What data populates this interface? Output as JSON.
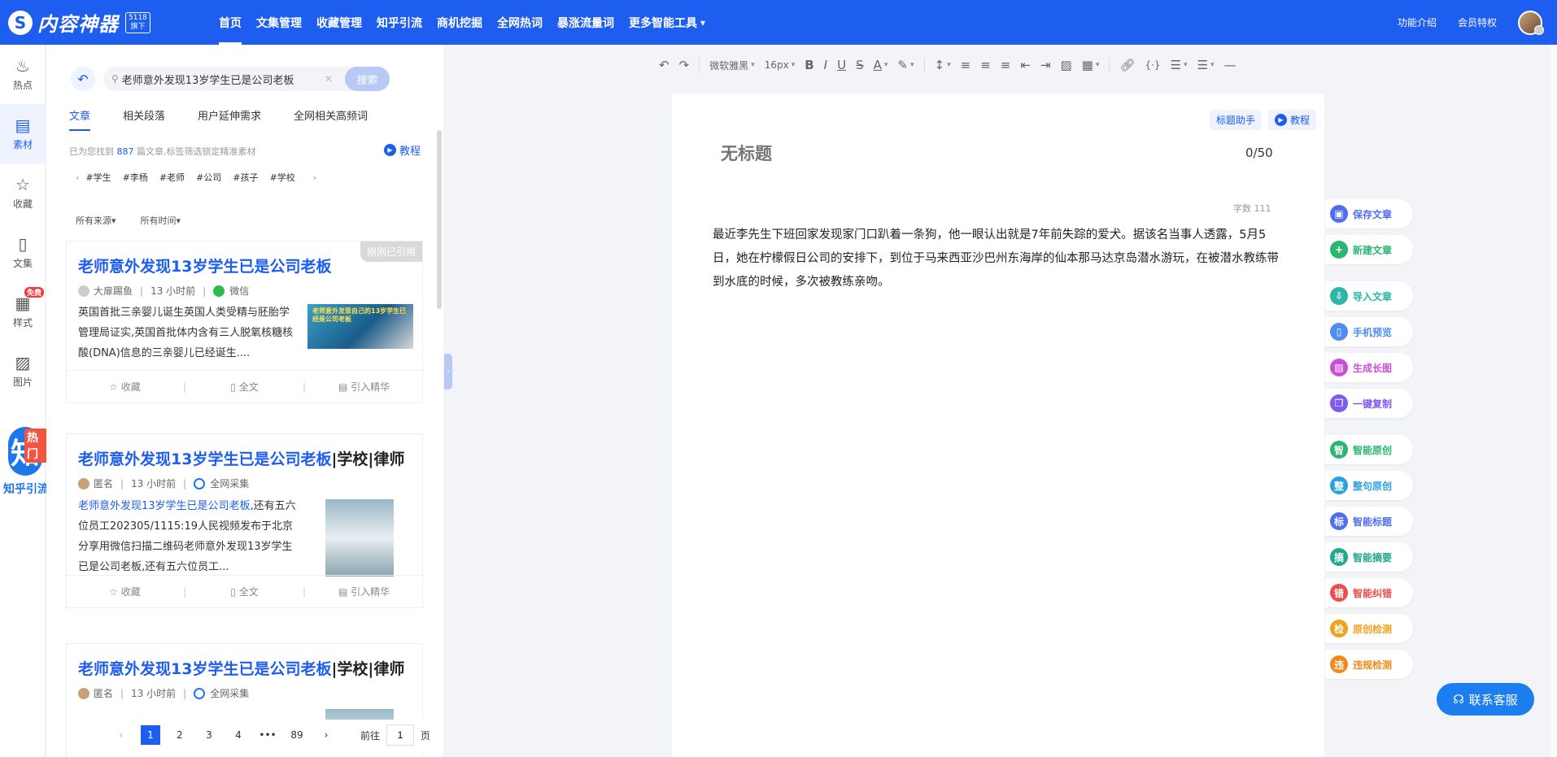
{
  "nav": {
    "logo_mark": "S",
    "logo_text": "内容神器",
    "logo_badge": "5118\n旗下",
    "items": [
      "首页",
      "文集管理",
      "收藏管理",
      "知乎引流",
      "商机挖掘",
      "全网热词",
      "暴涨流量词",
      "更多智能工具"
    ],
    "more_caret": "⌄",
    "right": [
      "功能介绍",
      "会员特权"
    ]
  },
  "rail": {
    "items": [
      {
        "label": "热点",
        "icon": "fire-icon",
        "glyph": "♨"
      },
      {
        "label": "素材",
        "icon": "material-icon",
        "glyph": "▤"
      },
      {
        "label": "收藏",
        "icon": "collect-icon",
        "glyph": "☆"
      },
      {
        "label": "文集",
        "icon": "doc-icon",
        "glyph": "▯"
      },
      {
        "label": "样式",
        "icon": "style-icon",
        "glyph": "▦"
      },
      {
        "label": "图片",
        "icon": "image-icon",
        "glyph": "▨"
      }
    ],
    "free_badge": "免费",
    "zhihu_char": "知",
    "zhihu_hot": "热门",
    "zhihu_label": "知乎引流"
  },
  "panel": {
    "search_value": "老师意外发现13岁学生已是公司老板",
    "search_btn": "搜索",
    "tabs": [
      "文章",
      "相关段落",
      "用户延伸需求",
      "全网相关高频词"
    ],
    "found_prefix": "已为您找到",
    "found_num": "887",
    "found_suffix": "篇文章,标签筛选锁定精准素材",
    "tutorial": "教程",
    "tags": [
      "#学生",
      "#李杨",
      "#老师",
      "#公司",
      "#孩子",
      "#学校"
    ],
    "filters": [
      "所有来源▾",
      "所有时间▾"
    ],
    "cards": [
      {
        "title": "老师意外发现13岁学生已是公司老板",
        "title_suffix": "",
        "quoted": "刚刚已引用",
        "author": "大扉踢鱼",
        "time": "13 小时前",
        "source": "微信",
        "text": "英国首批三亲婴儿诞生英国人类受精与胚胎学管理局证实,英国首批体内含有三人脱氧核糖核酸(DNA)信息的三亲婴儿已经诞生....",
        "text_hl": "",
        "thumb_caption": "老师意外发现自己的13岁学生已经是公司老板"
      },
      {
        "title": "老师意外发现13岁学生已是公司老板",
        "title_suffix": "|学校|律师",
        "author": "匿名",
        "time": "13 小时前",
        "source": "全网采集",
        "text_hl": "老师意外发现13岁学生已是公司老板",
        "text": ",还有五六位员工202305/1115:19人民视频发布于北京分享用微信扫描二维码老师意外发现13岁学生已是公司老板,还有五六位员工..."
      },
      {
        "title": "老师意外发现13岁学生已是公司老板",
        "title_suffix": "|学校|律师",
        "author": "匿名",
        "time": "13 小时前",
        "source": "全网采集"
      }
    ],
    "actions": [
      "☆ 收藏",
      "▯ 全文",
      "▤ 引入精华"
    ],
    "pages": [
      "1",
      "2",
      "3",
      "4",
      "•••",
      "89"
    ],
    "goto_prefix": "前往",
    "goto_value": "1",
    "goto_suffix": "页"
  },
  "toolbar": {
    "font": "微软雅黑",
    "size": "16px"
  },
  "editor": {
    "title_help": "标题助手",
    "tutorial": "教程",
    "title_placeholder": "无标题",
    "title_count": "0/50",
    "word_count": "字数 111",
    "body": "最近李先生下班回家发现家门口趴着一条狗，他一眼认出就是7年前失踪的爱犬。据该名当事人透露，5月5日，她在柠檬假日公司的安排下，到位于马来西亚沙巴州东海岸的仙本那马达京岛潜水游玩，在被潜水教练带到水底的时候，多次被教练亲吻。"
  },
  "actions": [
    {
      "label": "保存文章",
      "icon": "save-icon",
      "glyph": "▣",
      "color": "#4f6ff0"
    },
    {
      "label": "新建文章",
      "icon": "new-doc-icon",
      "glyph": "+",
      "color": "#2bb673"
    },
    {
      "label": "导入文章",
      "icon": "import-icon",
      "glyph": "⇩",
      "color": "#2bb6a9"
    },
    {
      "label": "手机预览",
      "icon": "phone-icon",
      "glyph": "▯",
      "color": "#4f8df0"
    },
    {
      "label": "生成长图",
      "icon": "long-image-icon",
      "glyph": "▨",
      "color": "#c94fd8"
    },
    {
      "label": "一键复制",
      "icon": "copy-icon",
      "glyph": "❐",
      "color": "#7e5cf0"
    },
    {
      "label": "智能原创",
      "icon": "ai-original-icon",
      "glyph": "智",
      "color": "#2bb673"
    },
    {
      "label": "整句原创",
      "icon": "sentence-original-icon",
      "glyph": "整",
      "color": "#2aa0e0"
    },
    {
      "label": "智能标题",
      "icon": "ai-title-icon",
      "glyph": "标",
      "color": "#4f6ff0"
    },
    {
      "label": "智能摘要",
      "icon": "ai-summary-icon",
      "glyph": "摘",
      "color": "#21a88a"
    },
    {
      "label": "智能纠错",
      "icon": "ai-correct-icon",
      "glyph": "错",
      "color": "#ee4d4d"
    },
    {
      "label": "原创检测",
      "icon": "original-check-icon",
      "glyph": "检",
      "color": "#f0a11d"
    },
    {
      "label": "违规检测",
      "icon": "violation-check-icon",
      "glyph": "违",
      "color": "#f08a1d"
    }
  ],
  "service": "联系客服"
}
